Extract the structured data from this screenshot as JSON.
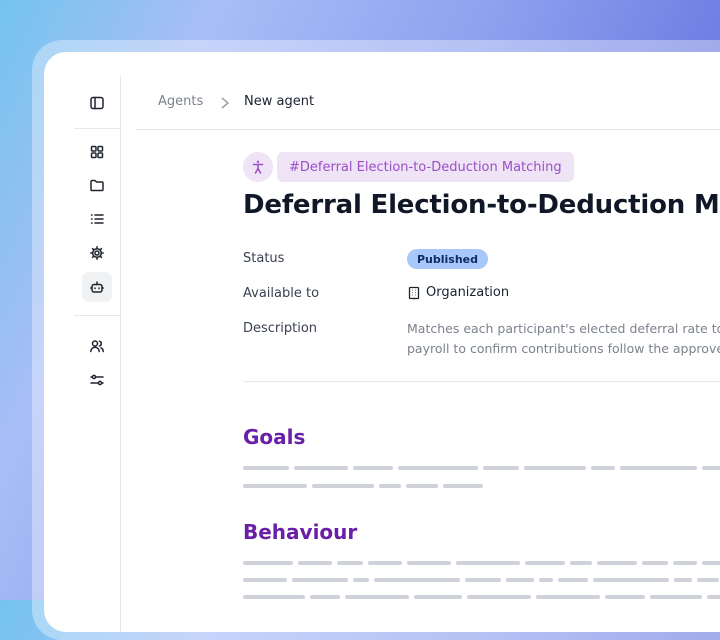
{
  "breadcrumb": {
    "parent": "Agents",
    "current": "New agent"
  },
  "sidebar": {
    "items": [
      {
        "icon": "panel-left-icon"
      },
      {
        "icon": "dashboard-icon"
      },
      {
        "icon": "folder-icon"
      },
      {
        "icon": "list-icon"
      },
      {
        "icon": "gear-icon"
      },
      {
        "icon": "bot-icon",
        "active": true
      },
      {
        "icon": "users-icon"
      },
      {
        "icon": "sliders-icon"
      }
    ]
  },
  "agent": {
    "tag": "#Deferral Election-to-Deduction Matching",
    "tag_icon": "accessibility-icon",
    "title": "Deferral Election-to-Deduction Matching",
    "fields": {
      "status_label": "Status",
      "status_value": "Published",
      "available_label": "Available to",
      "available_value": "Organization",
      "available_icon": "building-icon",
      "description_label": "Description",
      "description_line1": "Matches each participant's elected deferral rate to t",
      "description_line2": "payroll to confirm contributions follow the approve"
    }
  },
  "sections": {
    "goals": "Goals",
    "behaviour": "Behaviour"
  },
  "colors": {
    "accent_purple": "#6a1fa8",
    "tag_bg": "#efe3f6",
    "badge_bg": "#a8c7fa"
  }
}
